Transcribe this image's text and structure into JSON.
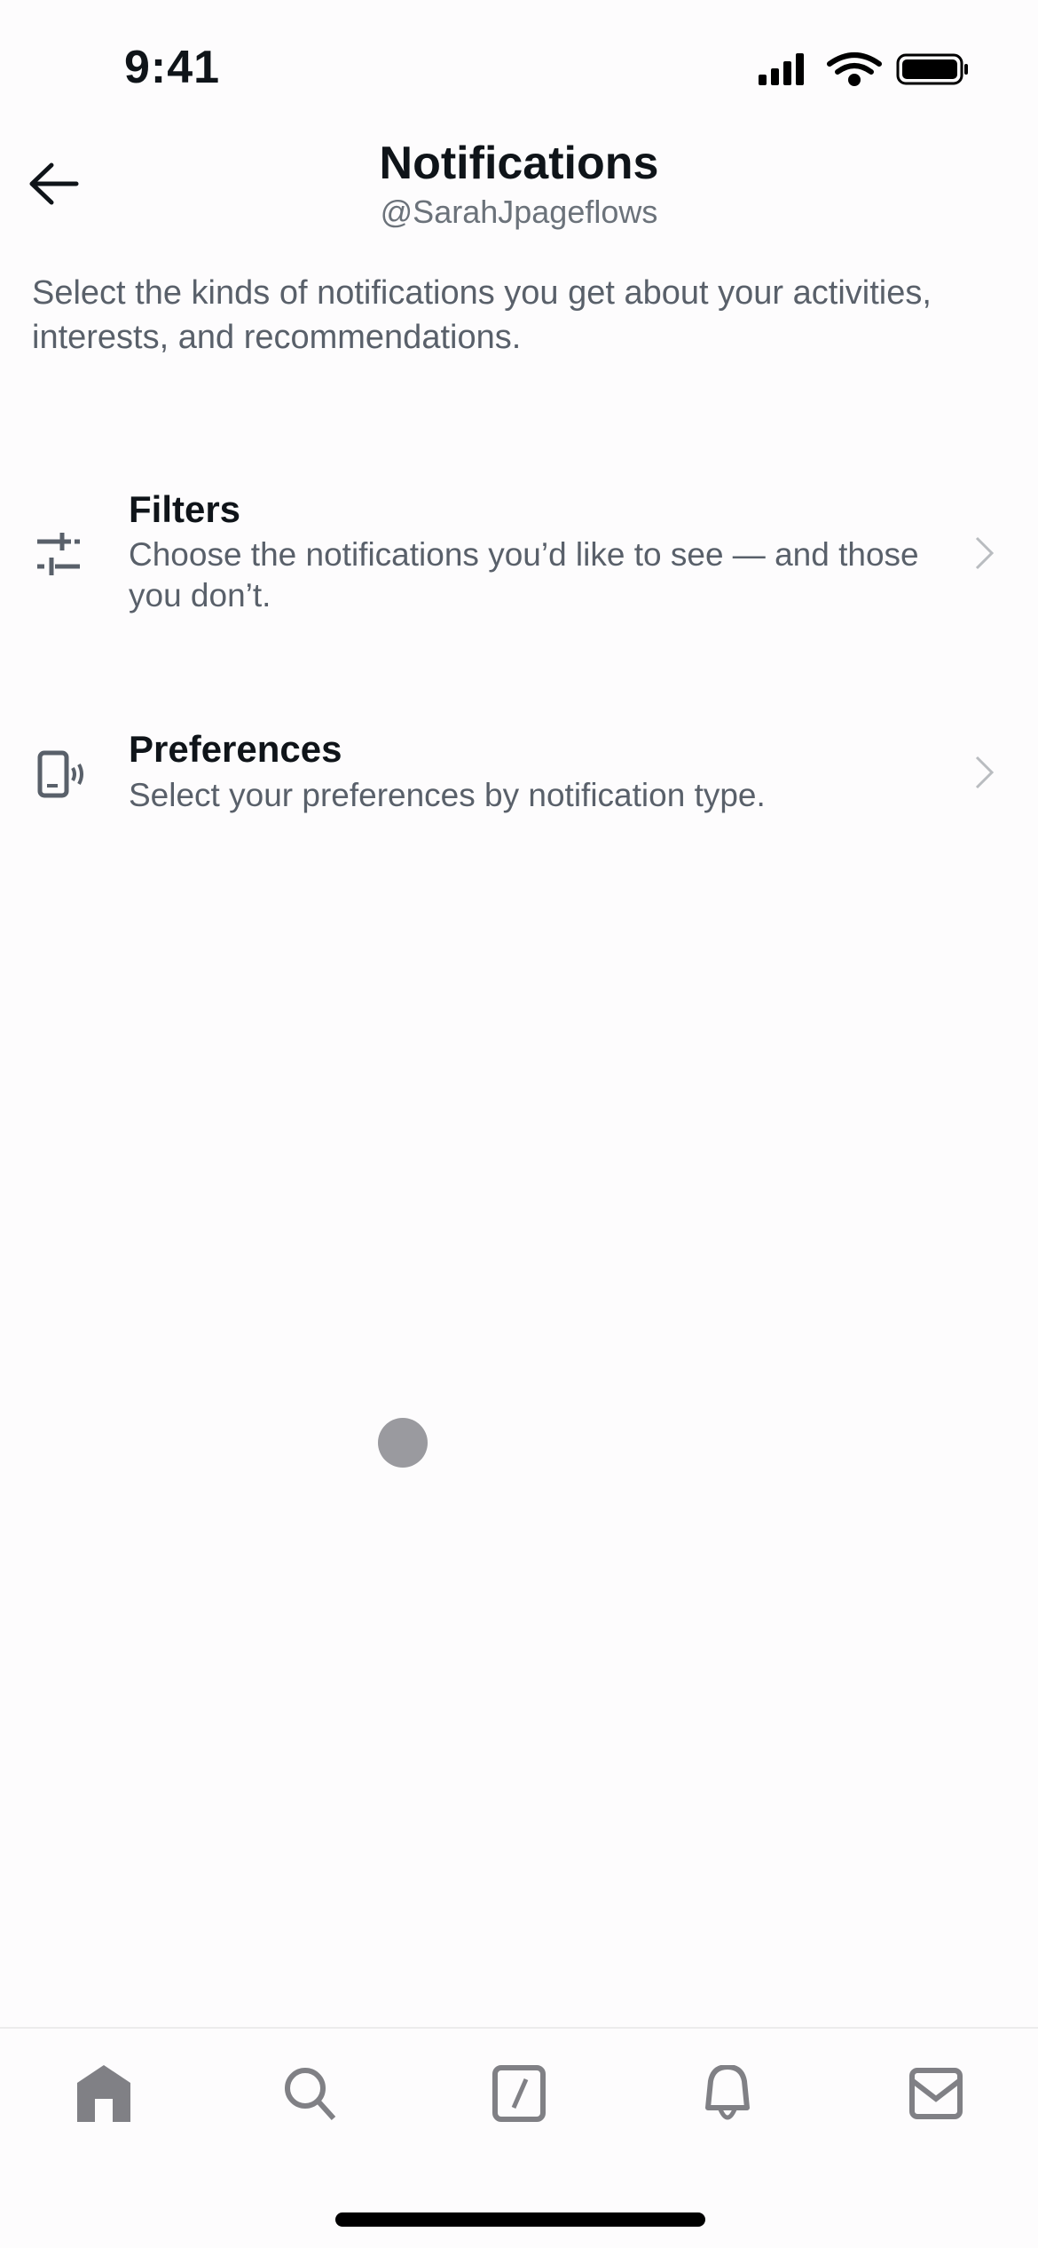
{
  "status_bar": {
    "time": "9:41"
  },
  "header": {
    "title": "Notifications",
    "handle": "@SarahJpageflows"
  },
  "description": "Select the kinds of notifications you get about your activities, interests, and recommendations.",
  "items": [
    {
      "title": "Filters",
      "subtitle": "Choose the notifications you’d like to see — and those you don’t.",
      "icon": "sliders-icon"
    },
    {
      "title": "Preferences",
      "subtitle": "Select your preferences by notification type.",
      "icon": "phone-vibrate-icon"
    }
  ],
  "tab_bar": [
    "home-icon",
    "search-icon",
    "compose-icon",
    "bell-icon",
    "mail-icon"
  ],
  "colors": {
    "icon": "#808085",
    "text_secondary": "#59606a"
  }
}
